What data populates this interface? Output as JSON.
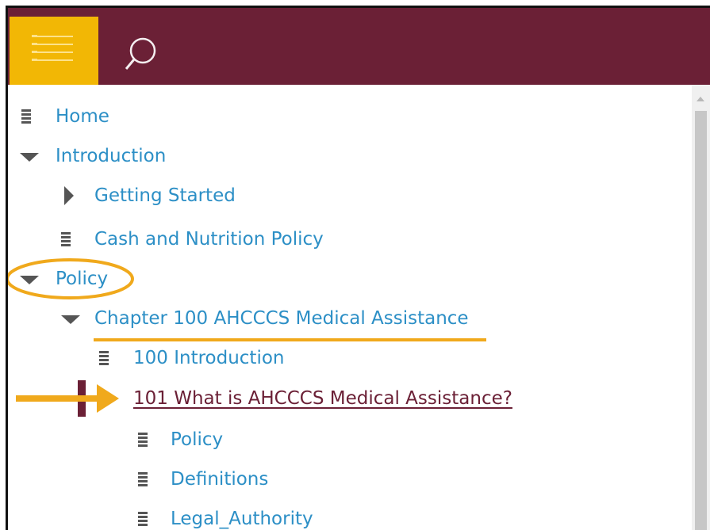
{
  "header": {
    "menu_icon": "list-menu-icon",
    "search_icon": "search-icon",
    "colors": {
      "bar": "#6b2036",
      "menu_button": "#f2b705",
      "link": "#2c8fc6",
      "active_link": "#6b2036",
      "annotation": "#f0a91c"
    }
  },
  "nav": {
    "home": "Home",
    "introduction": "Introduction",
    "getting_started": "Getting Started",
    "cash_nutrition": "Cash and Nutrition Policy",
    "policy": "Policy",
    "chapter_100": "Chapter 100 AHCCCS Medical Assistance",
    "intro_100": "100 Introduction",
    "item_101": "101 What is AHCCCS Medical Assistance?",
    "sub_policy": "Policy",
    "definitions": "Definitions",
    "legal_authority": "Legal_Authority"
  }
}
